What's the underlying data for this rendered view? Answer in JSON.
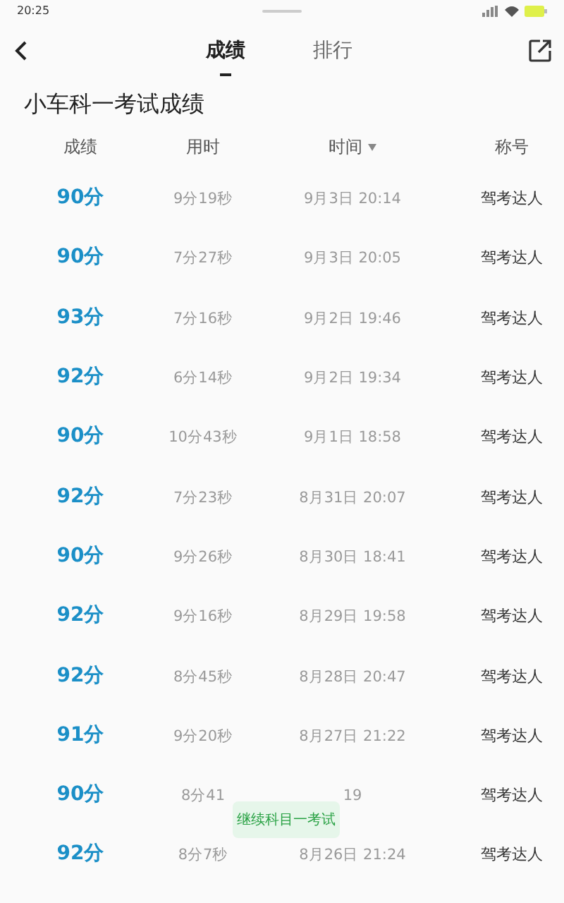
{
  "status_bar": {
    "time": "20:25"
  },
  "tabs": [
    {
      "label": "成绩",
      "selected": true
    },
    {
      "label": "排行",
      "selected": false
    }
  ],
  "title": "小车科一考试成绩",
  "table": {
    "columns": [
      {
        "label": "成绩",
        "sortable": false
      },
      {
        "label": "用时",
        "sortable": false
      },
      {
        "label": "时间",
        "sortable": true
      },
      {
        "label": "称号",
        "sortable": false
      }
    ],
    "rows": [
      {
        "score": "90分",
        "duration": "9分19秒",
        "time": "9月3日 20:14",
        "title": "驾考达人"
      },
      {
        "score": "90分",
        "duration": "7分27秒",
        "time": "9月3日 20:05",
        "title": "驾考达人"
      },
      {
        "score": "93分",
        "duration": "7分16秒",
        "time": "9月2日 19:46",
        "title": "驾考达人"
      },
      {
        "score": "92分",
        "duration": "6分14秒",
        "time": "9月2日 19:34",
        "title": "驾考达人"
      },
      {
        "score": "90分",
        "duration": "10分43秒",
        "time": "9月1日 18:58",
        "title": "驾考达人"
      },
      {
        "score": "92分",
        "duration": "7分23秒",
        "time": "8月31日 20:07",
        "title": "驾考达人"
      },
      {
        "score": "90分",
        "duration": "9分26秒",
        "time": "8月30日 18:41",
        "title": "驾考达人"
      },
      {
        "score": "92分",
        "duration": "9分16秒",
        "time": "8月29日 19:58",
        "title": "驾考达人"
      },
      {
        "score": "92分",
        "duration": "8分45秒",
        "time": "8月28日 20:47",
        "title": "驾考达人"
      },
      {
        "score": "91分",
        "duration": "9分20秒",
        "time": "8月27日 21:22",
        "title": "驾考达人"
      },
      {
        "score": "90分",
        "duration": "8分41",
        "time": "19",
        "title": "驾考达人"
      },
      {
        "score": "92分",
        "duration": "8分7秒",
        "time": "8月26日 21:24",
        "title": "驾考达人"
      }
    ]
  },
  "floating_button": {
    "label": "继续科目一考试"
  }
}
